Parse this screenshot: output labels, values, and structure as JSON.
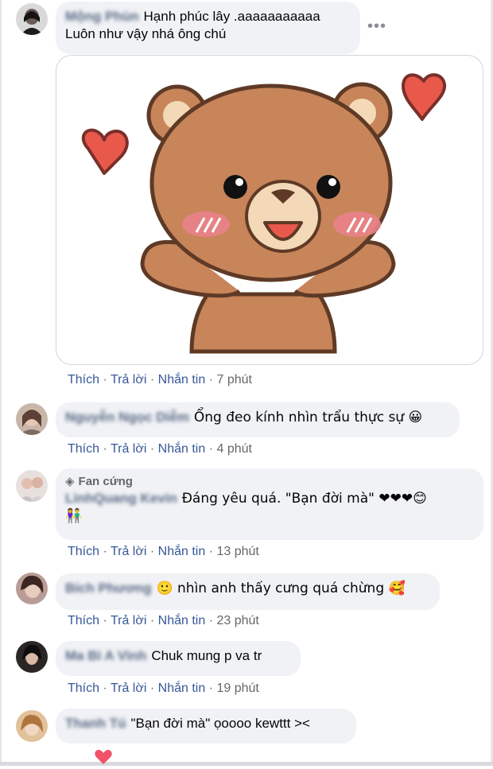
{
  "comments": [
    {
      "name": "Mộng Phùn",
      "text": "Hạnh phúc lây .aaaaaaaaaaa",
      "text2": "Luôn như vậy nhá ông chú",
      "actions": {
        "like": "Thích",
        "reply": "Trả lời",
        "message": "Nhắn tin",
        "time": "7 phút"
      }
    },
    {
      "name": "Nguyễn Ngọc Diễm",
      "text": "Ổng đeo kính nhìn trẩu thực sự 😀",
      "actions": {
        "like": "Thích",
        "reply": "Trả lời",
        "message": "Nhắn tin",
        "time": "4 phút"
      }
    },
    {
      "badge": "Fan cứng",
      "name": "LinhQuang Kevin",
      "text": "Đáng yêu quá. \"Bạn đời mà\" ❤❤❤😊",
      "text2": "👫",
      "actions": {
        "like": "Thích",
        "reply": "Trả lời",
        "message": "Nhắn tin",
        "time": "13 phút"
      }
    },
    {
      "name": "Bích Phương",
      "text": "🙂 nhìn anh thấy cưng quá chừng 🥰",
      "actions": {
        "like": "Thích",
        "reply": "Trả lời",
        "message": "Nhắn tin",
        "time": "23 phút"
      }
    },
    {
      "name": "Ma Bi A Vinh",
      "text": "Chuk mung p va tr",
      "actions": {
        "like": "Thích",
        "reply": "Trả lời",
        "message": "Nhắn tin",
        "time": "19 phút"
      }
    },
    {
      "name": "Thanh Tú",
      "text": "\"Bạn đời mà\" ọoooo kewttt ><"
    }
  ],
  "separator": "·",
  "more_icon": "more-horizontal-icon",
  "colors": {
    "link": "#385898",
    "bubble": "#f0f2f5",
    "bear": "#c8855a",
    "heart": "#e8594c"
  }
}
